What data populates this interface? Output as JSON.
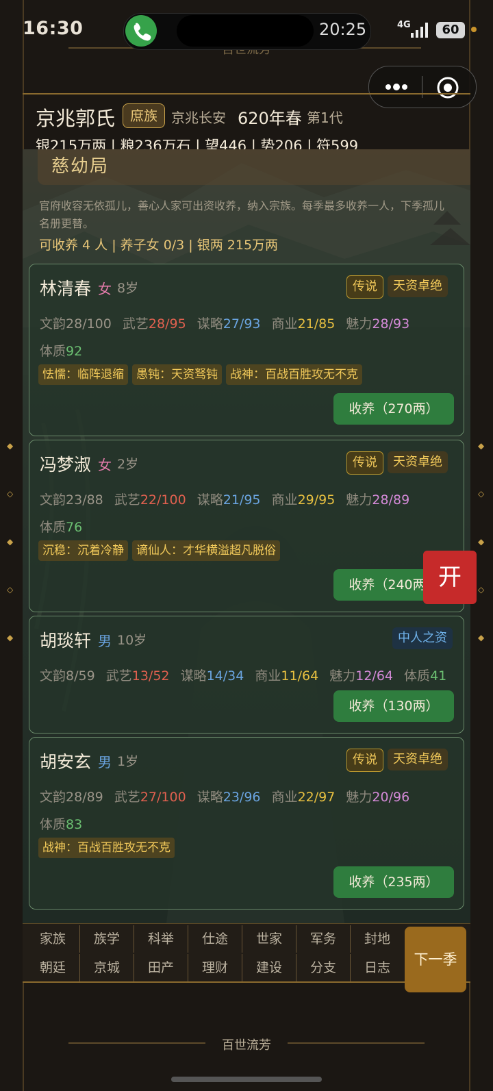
{
  "status_bar": {
    "time_left": "16:30",
    "call_time": "20:25",
    "network": "4G",
    "battery": "60"
  },
  "app_title": "百世流芳",
  "header": {
    "clan_name": "京兆郭氏",
    "clan_rank": "庶族",
    "location": "京兆长安",
    "year": "620年春",
    "generation": "第1代",
    "resources": "银215万两 | 粮236万石 | 望446 | 势206 | 符599"
  },
  "panel": {
    "title": "慈幼局",
    "description": "官府收容无依孤儿，善心人家可出资收养，纳入宗族。每季最多收养一人，下季孤儿名册更替。",
    "summary": "可收养 4 人 | 养子女 0/3 | 银两 215万两"
  },
  "children": [
    {
      "name": "林清春",
      "sex": "女",
      "age": "8岁",
      "tags": [
        "传说",
        "天资卓绝"
      ],
      "stats": [
        {
          "label": "文韵",
          "value": "28/100"
        },
        {
          "label": "武艺",
          "value": "28/95"
        },
        {
          "label": "谋略",
          "value": "27/93"
        },
        {
          "label": "商业",
          "value": "21/85"
        },
        {
          "label": "魅力",
          "value": "28/93"
        }
      ],
      "constitution": {
        "label": "体质",
        "value": "92"
      },
      "traits": [
        "怯懦：临阵退缩",
        "愚钝：天资驽钝",
        "战神：百战百胜攻无不克"
      ],
      "adopt_label": "收养（270两）"
    },
    {
      "name": "冯梦淑",
      "sex": "女",
      "age": "2岁",
      "tags": [
        "传说",
        "天资卓绝"
      ],
      "stats": [
        {
          "label": "文韵",
          "value": "23/88"
        },
        {
          "label": "武艺",
          "value": "22/100"
        },
        {
          "label": "谋略",
          "value": "21/95"
        },
        {
          "label": "商业",
          "value": "29/95"
        },
        {
          "label": "魅力",
          "value": "28/89"
        }
      ],
      "constitution": {
        "label": "体质",
        "value": "76"
      },
      "traits": [
        "沉稳：沉着冷静",
        "谪仙人：才华横溢超凡脱俗"
      ],
      "adopt_label": "收养（240两）"
    },
    {
      "name": "胡琰轩",
      "sex": "男",
      "age": "10岁",
      "tags": [
        "中人之资"
      ],
      "stats": [
        {
          "label": "文韵",
          "value": "8/59"
        },
        {
          "label": "武艺",
          "value": "13/52"
        },
        {
          "label": "谋略",
          "value": "14/34"
        },
        {
          "label": "商业",
          "value": "11/64"
        },
        {
          "label": "魅力",
          "value": "12/64"
        }
      ],
      "constitution": {
        "label": "体质",
        "value": "41"
      },
      "traits": [],
      "adopt_label": "收养（130两）"
    },
    {
      "name": "胡安玄",
      "sex": "男",
      "age": "1岁",
      "tags": [
        "传说",
        "天资卓绝"
      ],
      "stats": [
        {
          "label": "文韵",
          "value": "28/89"
        },
        {
          "label": "武艺",
          "value": "27/100"
        },
        {
          "label": "谋略",
          "value": "23/96"
        },
        {
          "label": "商业",
          "value": "22/97"
        },
        {
          "label": "魅力",
          "value": "20/96"
        }
      ],
      "constitution": {
        "label": "体质",
        "value": "83"
      },
      "traits": [
        "战神：百战百胜攻无不克"
      ],
      "adopt_label": "收养（235两）"
    }
  ],
  "float_button": "开",
  "nav": {
    "row1": [
      "家族",
      "族学",
      "科举",
      "仕途",
      "世家",
      "军务",
      "封地"
    ],
    "row2": [
      "朝廷",
      "京城",
      "田产",
      "理财",
      "建设",
      "分支",
      "日志"
    ],
    "next_season": "下一季"
  },
  "colors": {
    "stat_wenyun": "#9a9488",
    "stat_wuyi": "#e0604f",
    "stat_moulue": "#6aa4e0",
    "stat_shangye": "#e8c040",
    "stat_meili": "#d48ad8",
    "stat_tizhi": "#6cc072",
    "sex_female": "#e07aa8",
    "sex_male": "#6aa4e0"
  }
}
